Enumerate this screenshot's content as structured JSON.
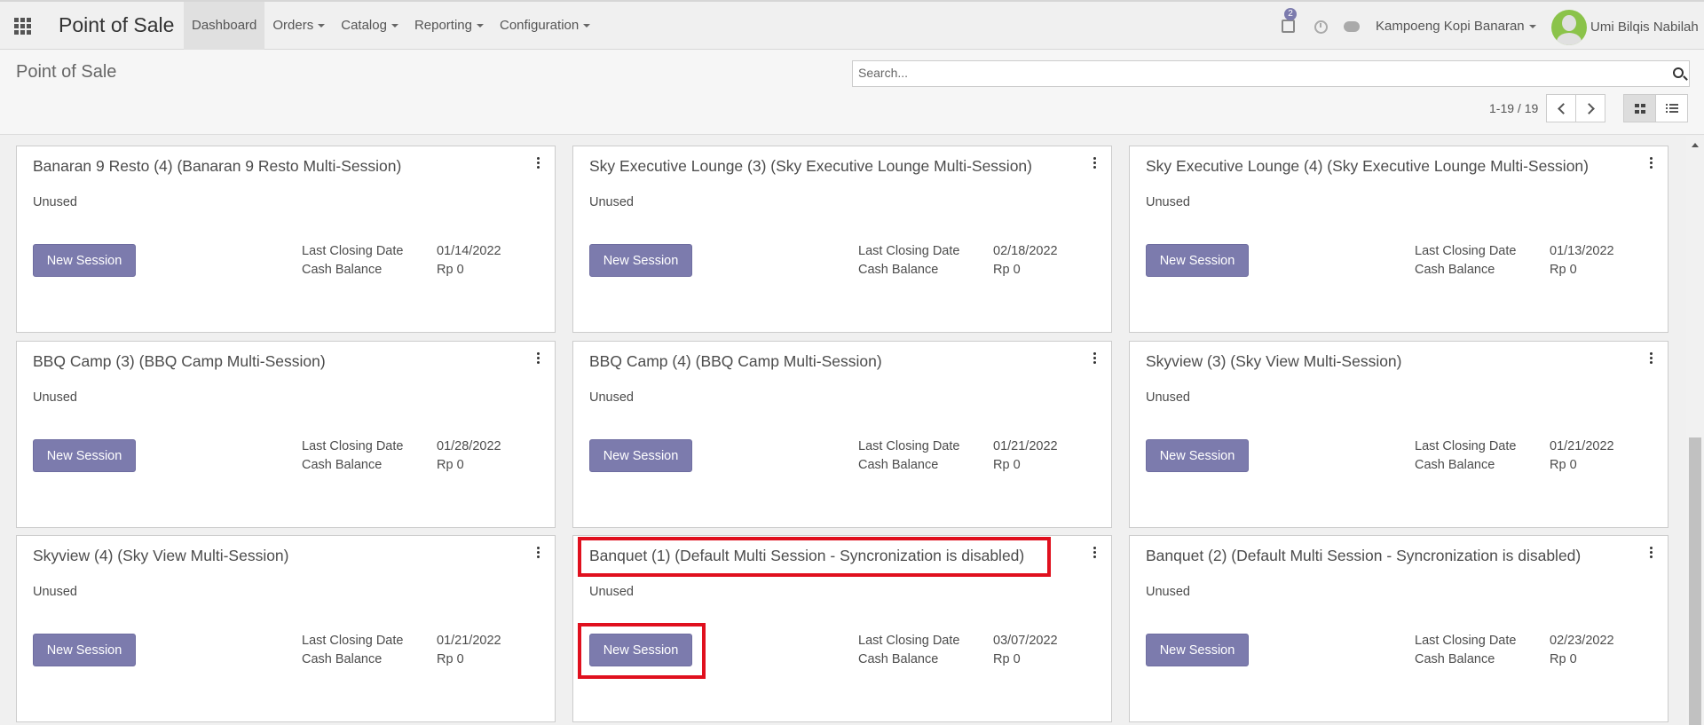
{
  "navbar": {
    "brand": "Point of Sale",
    "menu": [
      "Dashboard",
      "Orders",
      "Catalog",
      "Reporting",
      "Configuration"
    ],
    "activity_count": "2",
    "company": "Kampoeng Kopi Banaran",
    "user": "Umi Bilqis Nabilah"
  },
  "control_panel": {
    "breadcrumb": "Point of Sale",
    "search_placeholder": "Search...",
    "pager": "1-19 / 19"
  },
  "labels": {
    "new_session": "New Session",
    "last_closing_date": "Last Closing Date",
    "cash_balance": "Cash Balance"
  },
  "cards": [
    {
      "title": "Banaran 9 Resto (4) (Banaran 9 Resto Multi-Session)",
      "status": "Unused",
      "closing_date": "01/14/2022",
      "cash_balance": "Rp 0"
    },
    {
      "title": "Sky Executive Lounge (3) (Sky Executive Lounge Multi-Session)",
      "status": "Unused",
      "closing_date": "02/18/2022",
      "cash_balance": "Rp 0"
    },
    {
      "title": "Sky Executive Lounge (4) (Sky Executive Lounge Multi-Session)",
      "status": "Unused",
      "closing_date": "01/13/2022",
      "cash_balance": "Rp 0"
    },
    {
      "title": "BBQ Camp (3) (BBQ Camp Multi-Session)",
      "status": "Unused",
      "closing_date": "01/28/2022",
      "cash_balance": "Rp 0"
    },
    {
      "title": "BBQ Camp (4) (BBQ Camp Multi-Session)",
      "status": "Unused",
      "closing_date": "01/21/2022",
      "cash_balance": "Rp 0"
    },
    {
      "title": "Skyview (3) (Sky View Multi-Session)",
      "status": "Unused",
      "closing_date": "01/21/2022",
      "cash_balance": "Rp 0"
    },
    {
      "title": "Skyview (4) (Sky View Multi-Session)",
      "status": "Unused",
      "closing_date": "01/21/2022",
      "cash_balance": "Rp 0"
    },
    {
      "title": "Banquet (1) (Default Multi Session - Syncronization is disabled)",
      "status": "Unused",
      "closing_date": "03/07/2022",
      "cash_balance": "Rp 0"
    },
    {
      "title": "Banquet (2) (Default Multi Session - Syncronization is disabled)",
      "status": "Unused",
      "closing_date": "02/23/2022",
      "cash_balance": "Rp 0"
    }
  ],
  "colors": {
    "primary_button": "#7c7bad",
    "highlight": "#e0101e"
  }
}
